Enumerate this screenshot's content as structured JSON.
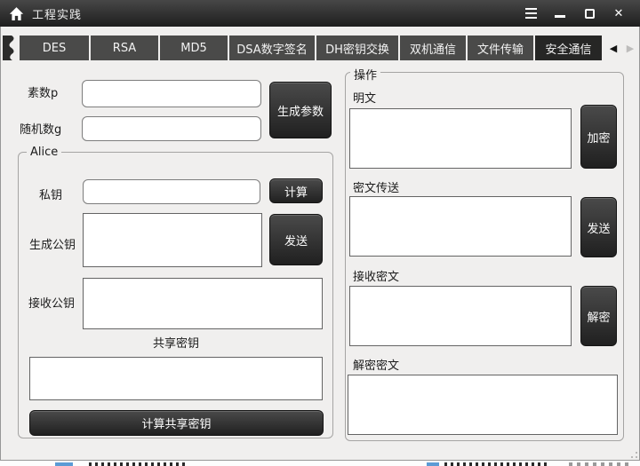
{
  "window": {
    "title": "工程实践",
    "controls": {
      "close": "✕"
    }
  },
  "tabs": {
    "items": [
      {
        "label": "DES"
      },
      {
        "label": "RSA"
      },
      {
        "label": "MD5"
      },
      {
        "label": "DSA数字签名"
      },
      {
        "label": "DH密钥交换"
      },
      {
        "label": "双机通信"
      },
      {
        "label": "文件传输"
      },
      {
        "label": "安全通信"
      }
    ],
    "selected": "安全通信",
    "scroll_left": "◀",
    "scroll_right": "▶"
  },
  "dh_panel": {
    "prime_label": "素数p",
    "prime_value": "",
    "random_label": "随机数g",
    "random_value": "",
    "generate_button": "生成参数",
    "alice": {
      "group_label": "Alice",
      "private_key_label": "私钥",
      "private_key_value": "",
      "calc_button": "计算",
      "gen_public_key_label": "生成公钥",
      "gen_public_key_value": "",
      "send_button": "发送",
      "recv_public_key_label": "接收公钥",
      "recv_public_key_value": "",
      "shared_key_label": "共享密钥",
      "shared_key_value": "",
      "calc_shared_button": "计算共享密钥"
    }
  },
  "operation_panel": {
    "group_label": "操作",
    "plaintext_label": "明文",
    "plaintext_value": "",
    "encrypt_button": "加密",
    "cipher_send_label": "密文传送",
    "cipher_send_value": "",
    "send_button": "发送",
    "recv_cipher_label": "接收密文",
    "recv_cipher_value": "",
    "decrypt_button": "解密",
    "decrypted_label": "解密密文",
    "decrypted_value": ""
  },
  "colors": {
    "titlebar_top": "#474747",
    "titlebar_bottom": "#1e1e1e",
    "tab_normal": "#4a4a49",
    "tab_selected": "#262625",
    "window_bg": "#f0efee",
    "button_dark": "#202020",
    "accent_blue_fragment": "#5b9bd5"
  }
}
